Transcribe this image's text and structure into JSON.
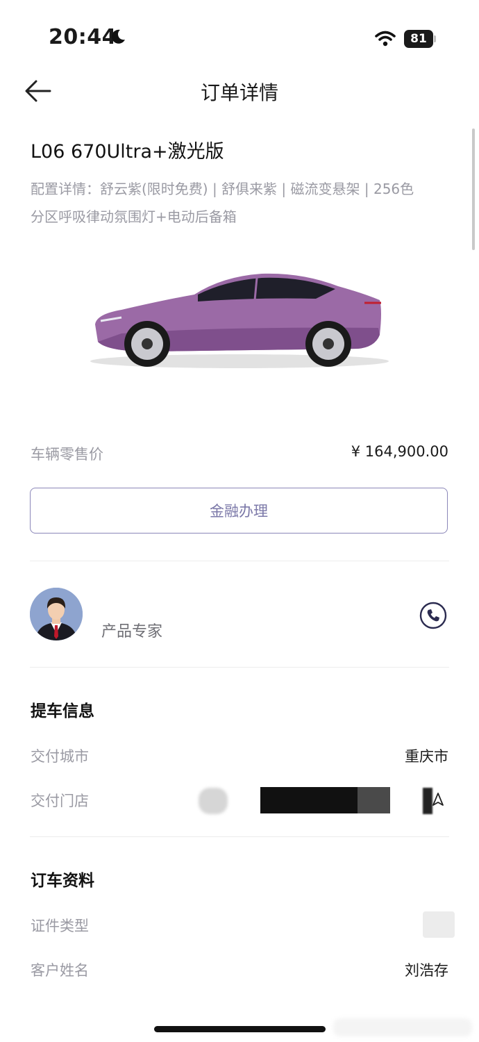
{
  "status_bar": {
    "time": "20:44",
    "battery": "81"
  },
  "header": {
    "title": "订单详情"
  },
  "vehicle": {
    "name": "L06 670Ultra+激光版",
    "config_line1": "配置详情：舒云紫(限时免费) | 舒俱来紫 | 磁流变悬架 | 256色",
    "config_line2": "分区呼吸律动氛围灯+电动后备箱",
    "body_color": "#9b6aa6"
  },
  "pricing": {
    "label": "车辆零售价",
    "value": "¥ 164,900.00"
  },
  "finance_button": {
    "label": "金融办理"
  },
  "expert": {
    "label": "产品专家"
  },
  "pickup": {
    "title": "提车信息",
    "city_label": "交付城市",
    "city_value": "重庆市",
    "store_label": "交付门店"
  },
  "booking": {
    "title": "订车资料",
    "id_type_label": "证件类型",
    "customer_name_label": "客户姓名",
    "customer_name_value": "刘浩存"
  },
  "colors": {
    "accent": "#7b78a8",
    "label_gray": "#9a9aa3"
  }
}
